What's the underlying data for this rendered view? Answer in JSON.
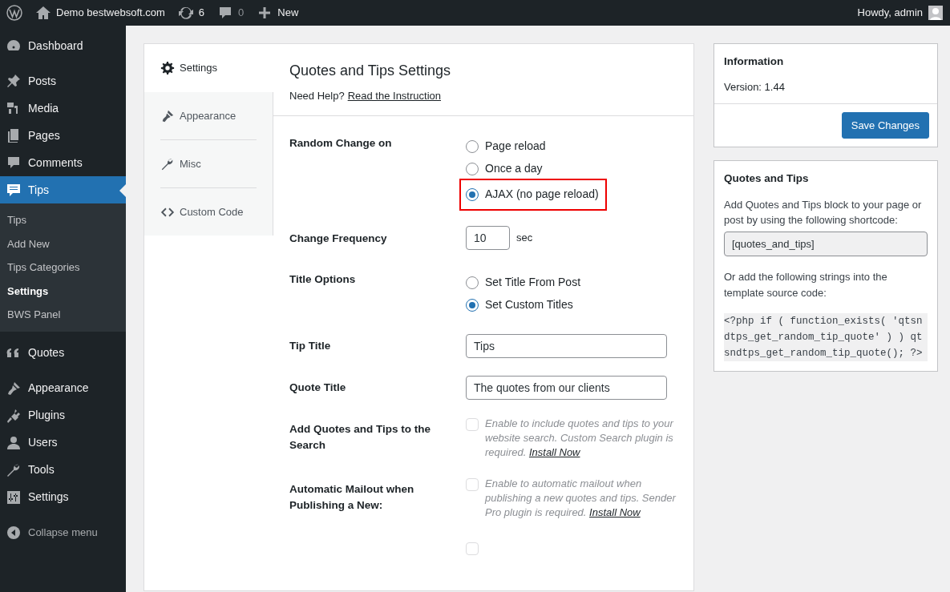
{
  "admin_bar": {
    "site": "Demo bestwebsoft.com",
    "updates": "6",
    "comments": "0",
    "new": "New",
    "greeting": "Howdy, admin"
  },
  "sidebar": {
    "items": [
      {
        "label": "Dashboard",
        "selected": false
      },
      {
        "label": "Posts",
        "selected": false
      },
      {
        "label": "Media",
        "selected": false
      },
      {
        "label": "Pages",
        "selected": false
      },
      {
        "label": "Comments",
        "selected": false
      },
      {
        "label": "Tips",
        "selected": true,
        "children": [
          {
            "label": "Tips",
            "selected": false
          },
          {
            "label": "Add New",
            "selected": false
          },
          {
            "label": "Tips Categories",
            "selected": false
          },
          {
            "label": "Settings",
            "selected": true
          },
          {
            "label": "BWS Panel",
            "selected": false
          }
        ]
      },
      {
        "label": "Quotes",
        "selected": false
      },
      {
        "label": "Appearance",
        "selected": false
      },
      {
        "label": "Plugins",
        "selected": false
      },
      {
        "label": "Users",
        "selected": false
      },
      {
        "label": "Tools",
        "selected": false
      },
      {
        "label": "Settings",
        "selected": false
      },
      {
        "label": "Collapse menu",
        "selected": false
      }
    ]
  },
  "tabs": [
    {
      "label": "Settings",
      "selected": true
    },
    {
      "label": "Appearance",
      "selected": false
    },
    {
      "label": "Misc",
      "selected": false
    },
    {
      "label": "Custom Code",
      "selected": false
    }
  ],
  "settings": {
    "title": "Quotes and Tips Settings",
    "help": "Need Help?",
    "help_link": "Read the Instruction",
    "rows": [
      {
        "kind": "radio",
        "label": "Random Change on",
        "options": [
          {
            "label": "Page reload",
            "selected": false,
            "highlighted": false
          },
          {
            "label": "Once a day",
            "selected": false,
            "highlighted": false
          },
          {
            "label": "AJAX (no page reload)",
            "selected": true,
            "highlighted": true
          }
        ]
      },
      {
        "kind": "number",
        "label": "Change Frequency",
        "value": "10",
        "unit": "sec"
      },
      {
        "kind": "radio",
        "label": "Title Options",
        "options": [
          {
            "label": "Set Title From Post",
            "selected": false,
            "highlighted": false
          },
          {
            "label": "Set Custom Titles",
            "selected": true,
            "highlighted": false
          }
        ]
      },
      {
        "kind": "text",
        "label": "Tip Title",
        "value": "Tips"
      },
      {
        "kind": "text",
        "label": "Quote Title",
        "value": "The quotes from our clients"
      },
      {
        "kind": "checkbox",
        "label": "Add Quotes and Tips to the Search",
        "checked": false,
        "description": "Enable to include quotes and tips to your website search. Custom Search plugin is required.",
        "link": "Install Now"
      },
      {
        "kind": "checkbox",
        "label": "Automatic Mailout when Publishing a New:",
        "checked": false,
        "description": "Enable to automatic mailout when publishing a new quotes and tips. Sender Pro plugin is required.",
        "link": "Install Now"
      },
      {
        "kind": "checkbox",
        "checked": false
      }
    ]
  },
  "info": {
    "title": "Information",
    "version": "Version: 1.44",
    "save": "Save Changes"
  },
  "shortcode_box": {
    "title": "Quotes and Tips",
    "text": "Add Quotes and Tips block to your page or post by using the following shortcode:",
    "shortcode": "[quotes_and_tips]",
    "text2": "Or add the following strings into the template source code:",
    "code": "<?php if ( function_exists( 'qtsndtps_get_random_tip_quote' ) ) qtsndtps_get_random_tip_quote(); ?>"
  }
}
